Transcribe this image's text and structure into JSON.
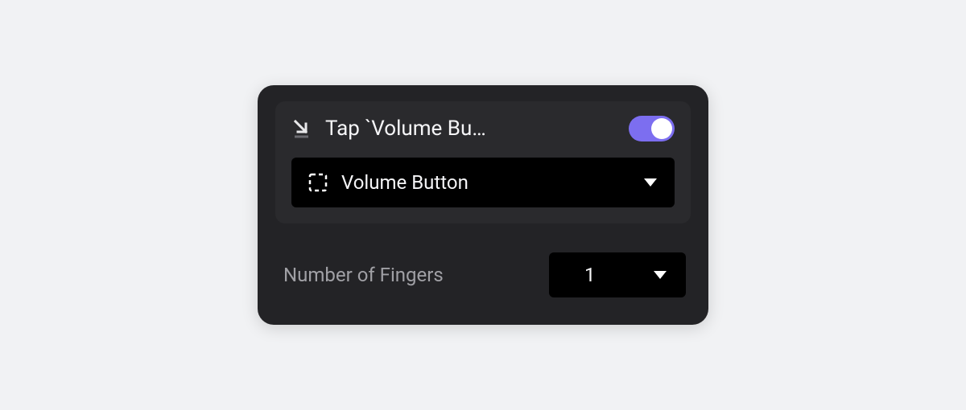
{
  "header": {
    "title": "Tap `Volume Bu…",
    "toggle_on": true
  },
  "target_select": {
    "label": "Volume Button"
  },
  "fingers": {
    "label": "Number of Fingers",
    "value": "1"
  }
}
